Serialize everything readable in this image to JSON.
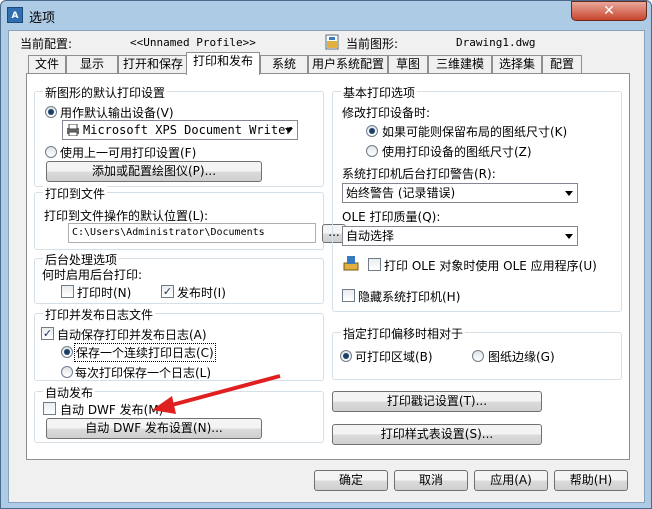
{
  "window": {
    "title": "选项",
    "app_icon": "A",
    "close_symbol": "✕"
  },
  "header": {
    "current_config_label": "当前配置:",
    "current_config_value": "<<Unnamed Profile>>",
    "current_drawing_label": "当前图形:",
    "current_drawing_value": "Drawing1.dwg"
  },
  "tabs": [
    "文件",
    "显示",
    "打开和保存",
    "打印和发布",
    "系统",
    "用户系统配置",
    "草图",
    "三维建模",
    "选择集",
    "配置"
  ],
  "active_tab": "打印和发布",
  "new_drawing": {
    "title": "新图形的默认打印设置",
    "use_default_label": "用作默认输出设备(V)",
    "device_value": "Microsoft XPS Document Writer",
    "use_last_label": "使用上一可用打印设置(F)",
    "add_plotter_label": "添加或配置绘图仪(P)..."
  },
  "plot_to_file": {
    "title": "打印到文件",
    "location_label": "打印到文件操作的默认位置(L):",
    "path_value": "C:\\Users\\Administrator\\Documents",
    "browse_label": "..."
  },
  "background": {
    "title": "后台处理选项",
    "enable_label": "何时启用后台打印:",
    "plotting_label": "打印时(N)",
    "publishing_label": "发布时(I)"
  },
  "log": {
    "title": "打印并发布日志文件",
    "auto_save_label": "自动保存打印并发布日志(A)",
    "continuous_label": "保存一个连续打印日志(C)",
    "per_plot_label": "每次打印保存一个日志(L)"
  },
  "autopublish": {
    "title": "自动发布",
    "auto_dwf_label": "自动 DWF 发布(M)",
    "settings_label": "自动 DWF 发布设置(N)..."
  },
  "general": {
    "title": "基本打印选项",
    "change_label": "修改打印设备时:",
    "keep_paper_label": "如果可能则保留布局的图纸尺寸(K)",
    "use_device_paper_label": "使用打印设备的图纸尺寸(Z)",
    "spool_label": "系统打印机后台打印警告(R):",
    "spool_value": "始终警告 (记录错误)",
    "ole_quality_label": "OLE 打印质量(Q):",
    "ole_value": "自动选择",
    "use_ole_app_label": "打印 OLE 对象时使用 OLE 应用程序(U)",
    "hide_printers_label": "隐藏系统打印机(H)"
  },
  "offset": {
    "title": "指定打印偏移时相对于",
    "printable_label": "可打印区域(B)",
    "edge_label": "图纸边缘(G)"
  },
  "stamp_button_label": "打印戳记设置(T)...",
  "style_button_label": "打印样式表设置(S)...",
  "footer": {
    "ok": "确定",
    "cancel": "取消",
    "apply": "应用(A)",
    "help": "帮助(H)"
  },
  "colors": {
    "annotation_arrow": "#e02020",
    "title_bar": "#aecbe6"
  }
}
